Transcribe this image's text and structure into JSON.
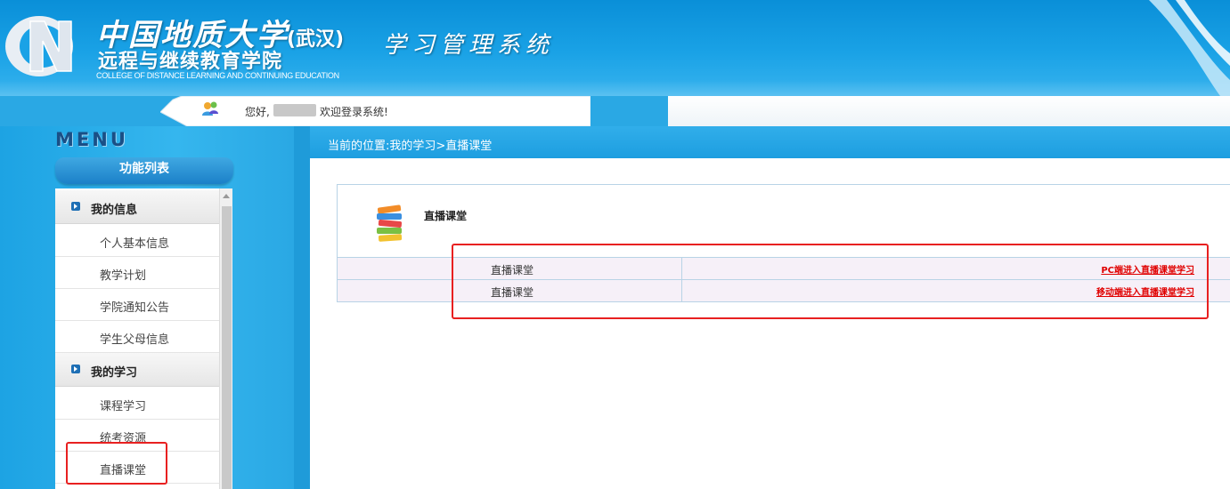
{
  "header": {
    "university_name": "中国地质大学",
    "university_branch": "(武汉)",
    "college_name_cn": "远程与继续教育学院",
    "college_name_en": "COLLEGE OF DISTANCE LEARNING AND CONTINUING EDUCATION",
    "system_title": "学习管理系统",
    "logo_icon": "cug-logo-icon"
  },
  "greeting": {
    "hello": "您好,",
    "username_redacted": true,
    "welcome": "欢迎登录系统!",
    "user_icon": "users-icon"
  },
  "sidebar": {
    "menu_title": "MENU",
    "function_list_title": "功能列表",
    "sections": [
      {
        "label": "我的信息",
        "items": [
          "个人基本信息",
          "教学计划",
          "学院通知公告",
          "学生父母信息"
        ]
      },
      {
        "label": "我的学习",
        "items": [
          "课程学习",
          "统考资源",
          "直播课堂"
        ]
      }
    ]
  },
  "breadcrumb": "当前的位置:我的学习>直播课堂",
  "content": {
    "title": "直播课堂",
    "icon": "books-icon",
    "rows": [
      {
        "name": "直播课堂",
        "link": "PC端进入直播课堂学习"
      },
      {
        "name": "直播课堂",
        "link": "移动端进入直播课堂学习"
      }
    ]
  },
  "colors": {
    "header_blue": "#0a8fd8",
    "link_red": "#e00000",
    "annotation_red": "#e82020",
    "row_bg": "#f6f0f8"
  }
}
